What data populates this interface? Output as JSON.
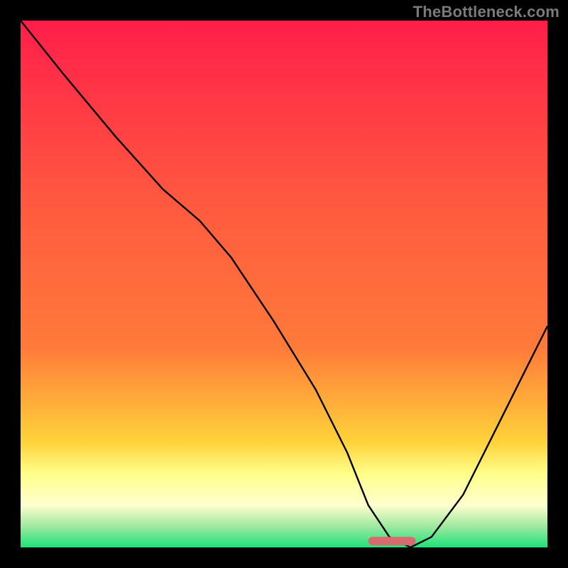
{
  "watermark": "TheBottleneck.com",
  "colors": {
    "frame": "#000000",
    "curve": "#000000",
    "marker_fill": "#d86a6f",
    "grad_top": "#ff1e4a",
    "grad_mid1": "#ff7a3a",
    "grad_mid2": "#ffd23a",
    "grad_yellowband_top": "#ffff8a",
    "grad_yellowband_bot": "#ffffcf",
    "grad_green": "#1de27a"
  },
  "chart_data": {
    "type": "line",
    "title": "",
    "xlabel": "",
    "ylabel": "",
    "xlim": [
      0,
      100
    ],
    "ylim": [
      0,
      100
    ],
    "series": [
      {
        "name": "bottleneck-curve",
        "x": [
          0,
          8,
          18,
          27,
          34,
          40,
          48,
          56,
          62,
          66,
          70,
          74,
          78,
          84,
          90,
          96,
          100
        ],
        "y": [
          100,
          90,
          78,
          68,
          62,
          55,
          43,
          30,
          18,
          8,
          2,
          0,
          2,
          10,
          22,
          34,
          42
        ]
      }
    ],
    "marker": {
      "x_start": 66,
      "x_end": 75,
      "y": 1.2
    },
    "gradient_stops_pct": [
      0,
      35,
      62,
      80,
      86,
      92,
      96,
      100
    ]
  }
}
